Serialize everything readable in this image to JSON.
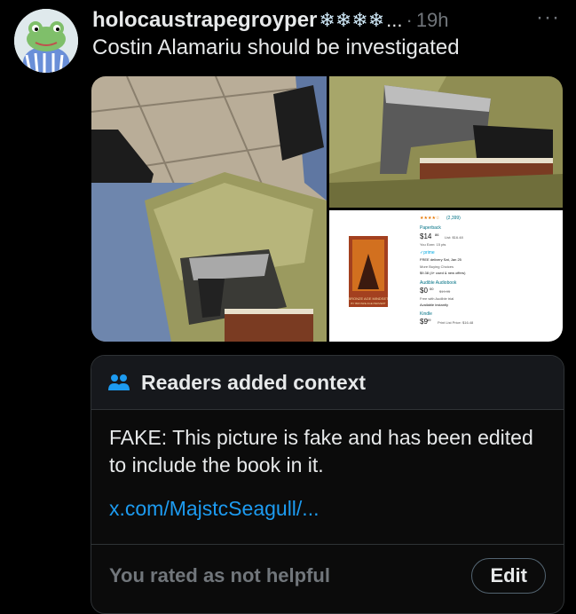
{
  "tweet": {
    "username": "holocaustrapegroyper",
    "name_suffix": "❄❄❄❄",
    "ellipsis": "...",
    "separator": "·",
    "time": "19h",
    "more_label": "···",
    "text": "Costin Alamariu should be investigated"
  },
  "media": {
    "amazon_listing": {
      "rating_count": "(2,399)",
      "format_paperback": "Paperback",
      "price_paperback": "$14",
      "price_paperback_cents": "86",
      "list_price": "List: $16.48",
      "you_earn": "You Earn: 15 pts",
      "prime": "✓prime",
      "delivery": "FREE delivery Sat, Jan 25",
      "buying_choices": "More Buying Choices",
      "buying_price": "$9.38 (4+ used & new offers)",
      "format_audio": "Audible Audiobook",
      "price_audio": "$0",
      "price_audio_cents": "00",
      "audio_strike": "$19.95",
      "audio_trial": "Free with Audible trial",
      "available": "Available instantly",
      "format_kindle": "Kindle",
      "price_kindle": "$9",
      "price_kindle_cents": "69",
      "kindle_list": "Print List Price: $16.48",
      "book_title": "BRONZE AGE MINDSET",
      "book_author": "BY BRONZE AGE PERVERT"
    },
    "book_spine_text": "BRONZE AGE MINDSET"
  },
  "note": {
    "heading": "Readers added context",
    "body": "FAKE: This picture is fake and has been edited to include the book in it.",
    "link": "x.com/MajstcSeagull/...",
    "rated": "You rated as not helpful",
    "edit_label": "Edit"
  },
  "colors": {
    "background": "#000000",
    "text_primary": "#e7e9ea",
    "text_secondary": "#71767b",
    "link": "#1d9bf0",
    "note_header_bg": "#16181c",
    "border": "#2f3336",
    "people_icon": "#1d9bf0"
  },
  "icons": {
    "avatar": "frog-avatar",
    "more": "more-horizontal-icon",
    "note": "people-icon"
  }
}
